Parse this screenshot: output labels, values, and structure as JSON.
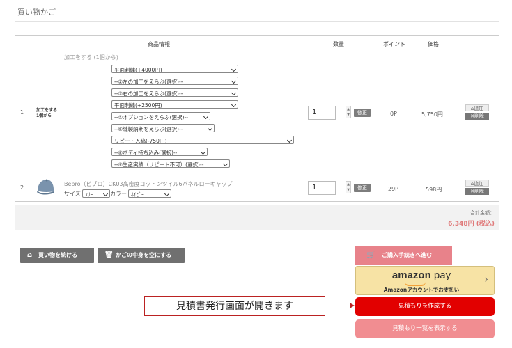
{
  "page": {
    "title": "買い物かご"
  },
  "table": {
    "headers": {
      "product": "商品情報",
      "qty": "数量",
      "points": "ポイント",
      "price": "価格"
    }
  },
  "item1": {
    "no": "1",
    "short_label_1": "加工をする",
    "short_label_2": "1個から",
    "proc_title": "加工をする (1個から)",
    "selects": [
      "平面刺繍(+4000円)",
      "--②左の加工をえらぶ(選択)--",
      "--③右の加工をえらぶ(選択)--",
      "平面刺繍(+2500円)",
      "--⑤オプションをえらぶ(選択)--",
      "--⑥縫製納期をえらぶ(選択)--",
      "リピート入稿(-750円)",
      "--⑧ボディ持ち込み(選択)--",
      "--⑨生産実績（リピート不可）(選択)--"
    ],
    "qty": "1",
    "fix": "修正",
    "points": "0P",
    "price": "5,750円",
    "add": "追加",
    "delete": "削除"
  },
  "item2": {
    "no": "2",
    "name": "Bebro（ビブロ）CK03高密度コットンツイル6パネルローキャップ",
    "size_label": "サイズ",
    "size_value": "ﾌﾘｰ",
    "color_label": "カラー",
    "color_value": "ﾈｲﾋﾞｰ",
    "qty": "1",
    "fix": "修正",
    "points": "29P",
    "price": "598円",
    "add": "追加",
    "delete": "削除"
  },
  "total": {
    "label": "合計金額：",
    "value": "6,348円 (税込)"
  },
  "buttons": {
    "continue": "買い物を続ける",
    "empty": "かごの中身を空にする",
    "checkout": "ご購入手続きへ進む",
    "amazon_logo_a": "amazon",
    "amazon_logo_b": "pay",
    "amazon_sub": "Amazonアカウントでお支払い",
    "quote_create": "見積もりを作成する",
    "quote_list": "見積もり一覧を表示する"
  },
  "annotation": {
    "callout": "見積書発行画面が開きます"
  },
  "colors": {
    "accent": "#e20000",
    "pink": "#f18d91",
    "checkout": "#e8828a",
    "amazon": "#f7e3a5",
    "callout_border": "#bb2222"
  },
  "icons": [
    "home-icon",
    "trash-icon",
    "cart-icon",
    "chevron-right-icon",
    "tag-icon",
    "close-icon",
    "cap-product-image"
  ]
}
